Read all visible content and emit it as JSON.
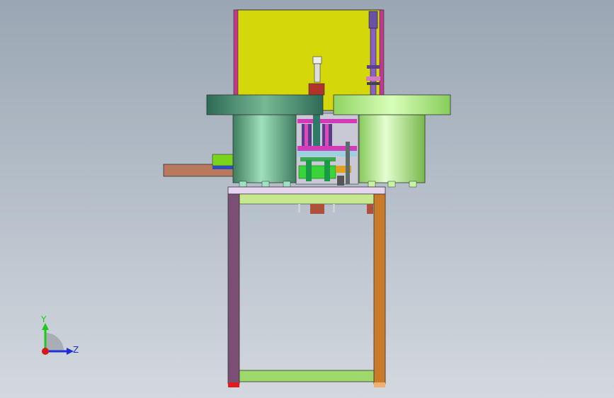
{
  "viewport": {
    "background_top": "#9aa6b3",
    "background_bottom": "#d3d8de"
  },
  "triad": {
    "y_label": "Y",
    "z_label": "Z",
    "y_color": "#1ec81e",
    "z_color": "#1f2fd6",
    "origin_color": "#d11a1a"
  },
  "colors": {
    "back_panel": "#d4d80a",
    "bowl_left": "#7fd3a6",
    "bowl_right": "#b8f07a",
    "frame_left": "#7a4f73",
    "frame_right": "#c87a28",
    "chute": "#b77a5c",
    "stretcher": "#9ed86a"
  }
}
